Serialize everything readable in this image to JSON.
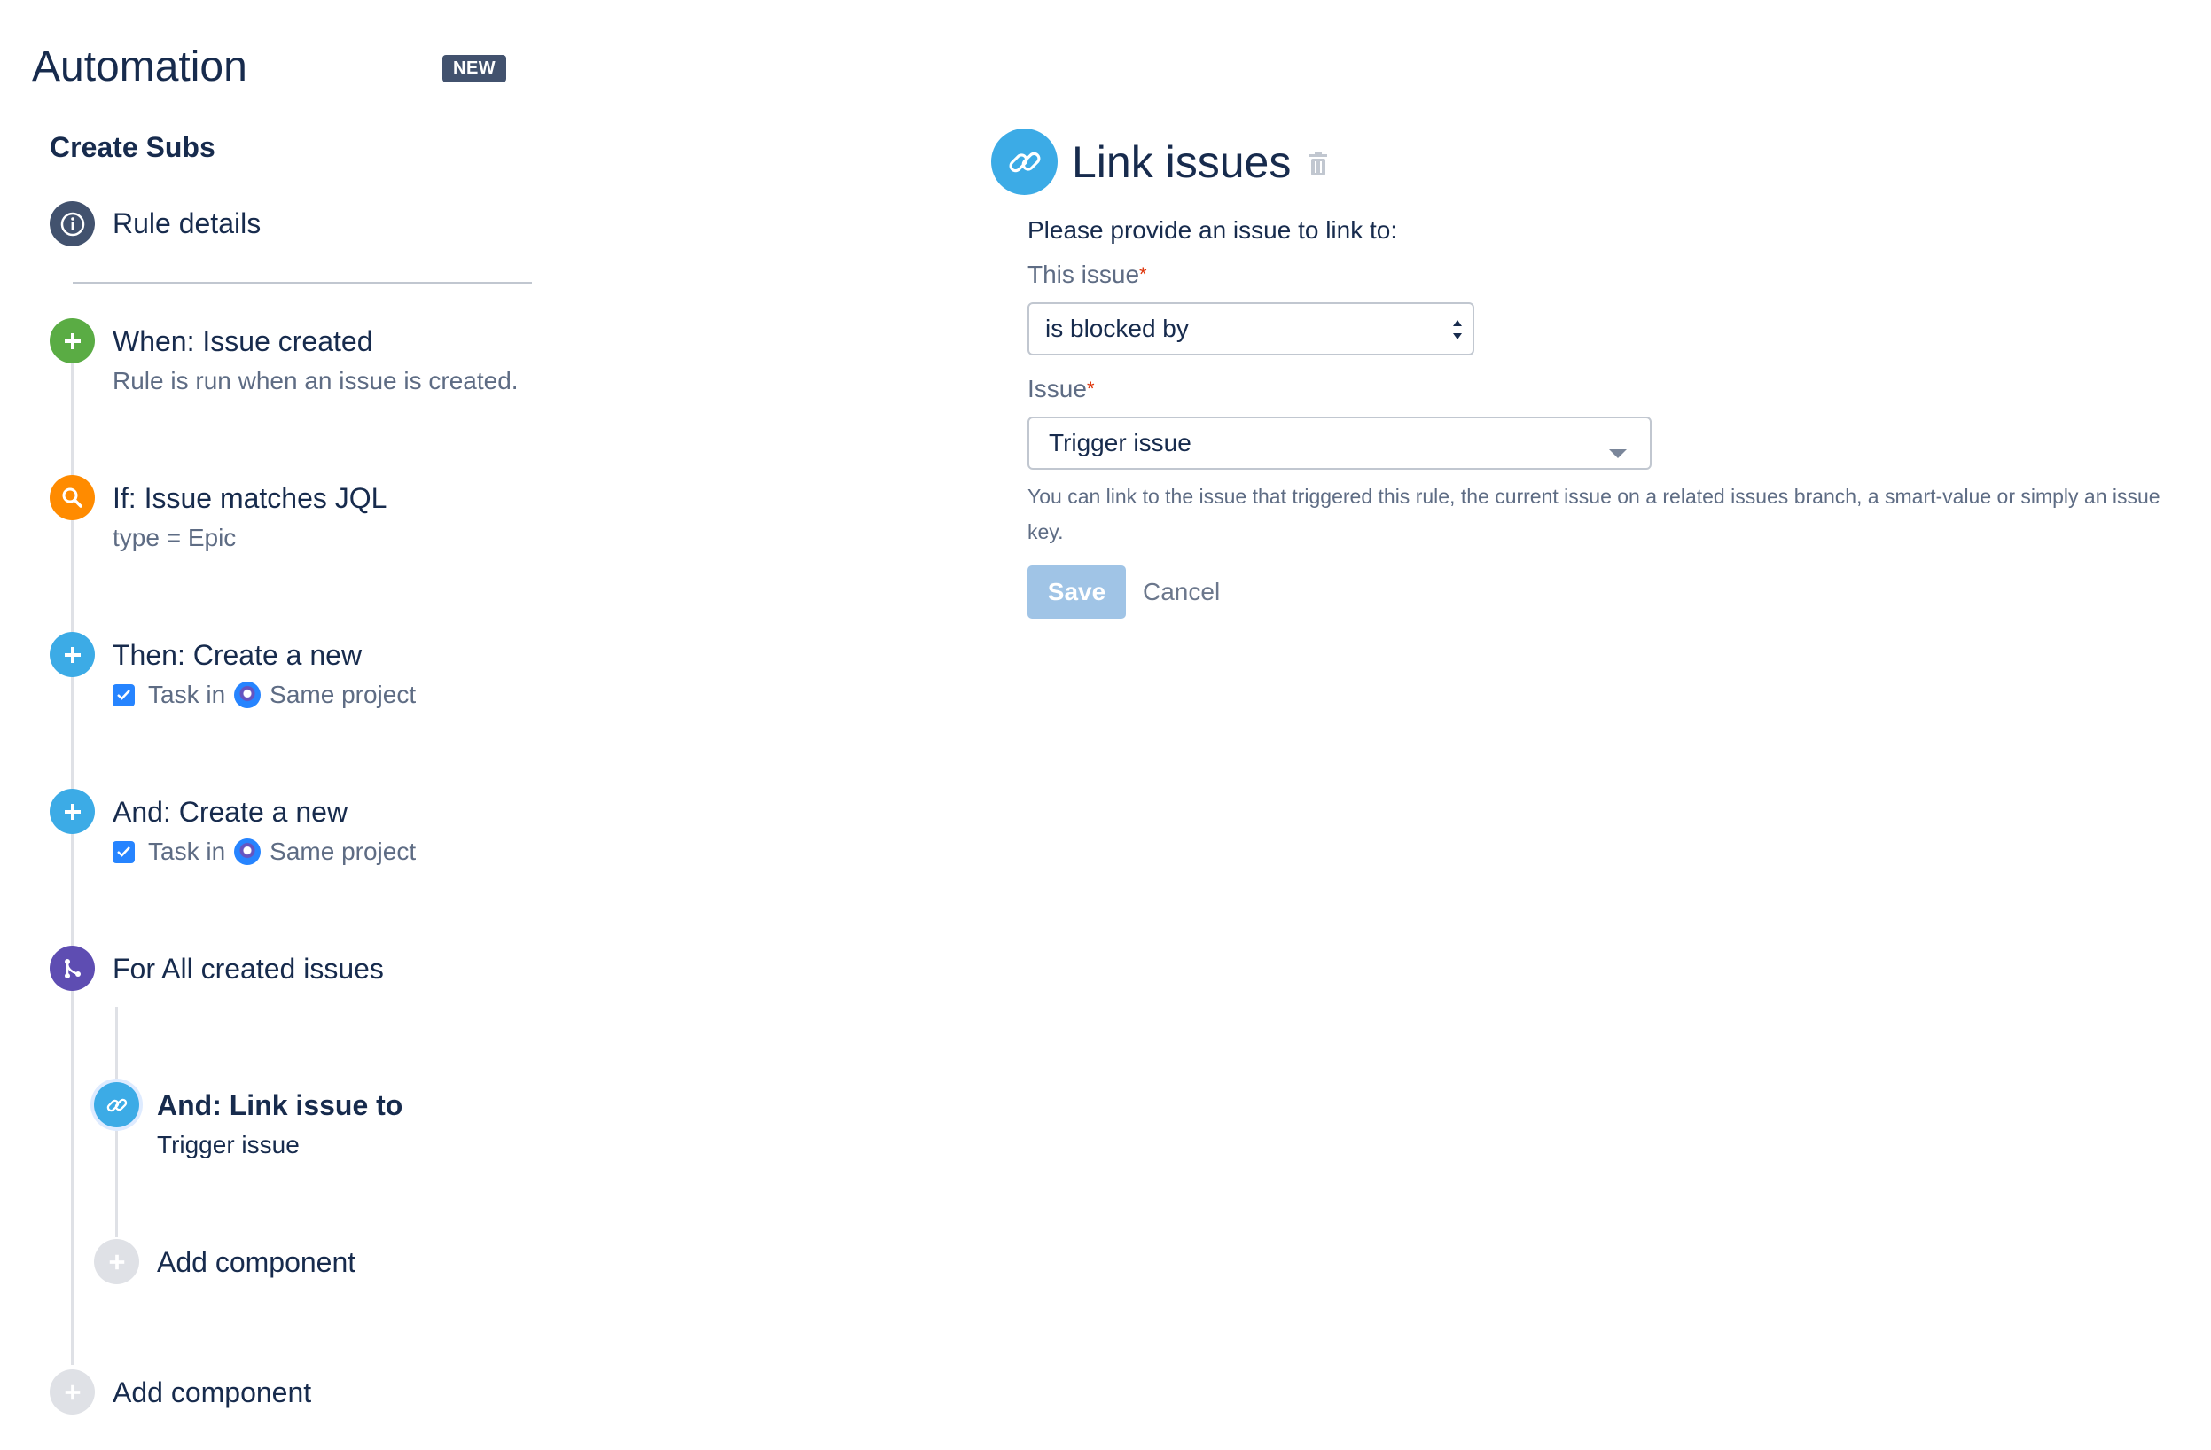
{
  "header": {
    "title": "Automation",
    "badge": "NEW"
  },
  "rule": {
    "name": "Create Subs"
  },
  "steps": {
    "details": {
      "title": "Rule details",
      "icon": "info-icon"
    },
    "trigger": {
      "title": "When: Issue created",
      "subtitle": "Rule is run when an issue is created.",
      "icon": "plus-icon",
      "color": "#5aac44"
    },
    "condition": {
      "title": "If: Issue matches JQL",
      "subtitle": "type = Epic",
      "icon": "search-icon",
      "color": "#ff8b00"
    },
    "action1": {
      "title": "Then: Create a new",
      "task": "Task in",
      "project": "Same project",
      "icon": "plus-icon",
      "color": "#3cabe6"
    },
    "action2": {
      "title": "And: Create a new",
      "task": "Task in",
      "project": "Same project",
      "icon": "plus-icon",
      "color": "#3cabe6"
    },
    "branch": {
      "title": "For All created issues",
      "icon": "branch-icon",
      "color": "#5e4db2"
    },
    "branch_action": {
      "title": "And: Link issue to",
      "subtitle": "Trigger issue",
      "icon": "link-icon",
      "color": "#3cabe6"
    },
    "branch_add": {
      "label": "Add component",
      "icon": "plus-icon"
    },
    "root_add": {
      "label": "Add component",
      "icon": "plus-icon"
    }
  },
  "panel": {
    "title": "Link issues",
    "prompt": "Please provide an issue to link to:",
    "this_issue_label": "This issue",
    "this_issue_value": "is blocked by",
    "issue_label": "Issue",
    "issue_value": "Trigger issue",
    "help_text": "You can link to the issue that triggered this rule, the current issue on a related issues branch, a smart-value or simply an issue key.",
    "save_label": "Save",
    "cancel_label": "Cancel",
    "required_marker": "*"
  },
  "colors": {
    "accent": "#3cabe6",
    "info": "#42526e",
    "save_disabled": "#a0c4e6",
    "required": "#de350b"
  }
}
